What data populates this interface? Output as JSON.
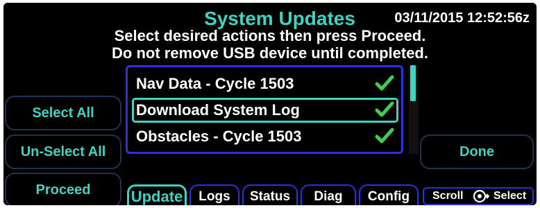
{
  "header": {
    "title": "System Updates",
    "datetime": "03/11/2015 12:52:56z",
    "instruction_1": "Select desired actions then press Proceed.",
    "instruction_2": "Do not remove USB device until completed."
  },
  "update_list": {
    "items": [
      {
        "label": "Nav Data - Cycle 1503",
        "checked": true,
        "selected": false
      },
      {
        "label": "Download System Log",
        "checked": true,
        "selected": true
      },
      {
        "label": "Obstacles - Cycle 1503",
        "checked": true,
        "selected": false
      }
    ],
    "check_color": "#3fcf4a",
    "highlight_color": "#3fd3c4",
    "border_color": "#2b2fe6"
  },
  "buttons": {
    "select_all": "Select All",
    "unselect_all": "Un-Select All",
    "proceed": "Proceed",
    "done": "Done"
  },
  "tabs": [
    {
      "label": "Update",
      "active": true
    },
    {
      "label": "Logs",
      "active": false
    },
    {
      "label": "Status",
      "active": false
    },
    {
      "label": "Diag",
      "active": false
    },
    {
      "label": "Config",
      "active": false
    }
  ],
  "footer": {
    "scroll_label": "Scroll",
    "knob_icon": "knob-push-icon",
    "select_label": "Select"
  }
}
